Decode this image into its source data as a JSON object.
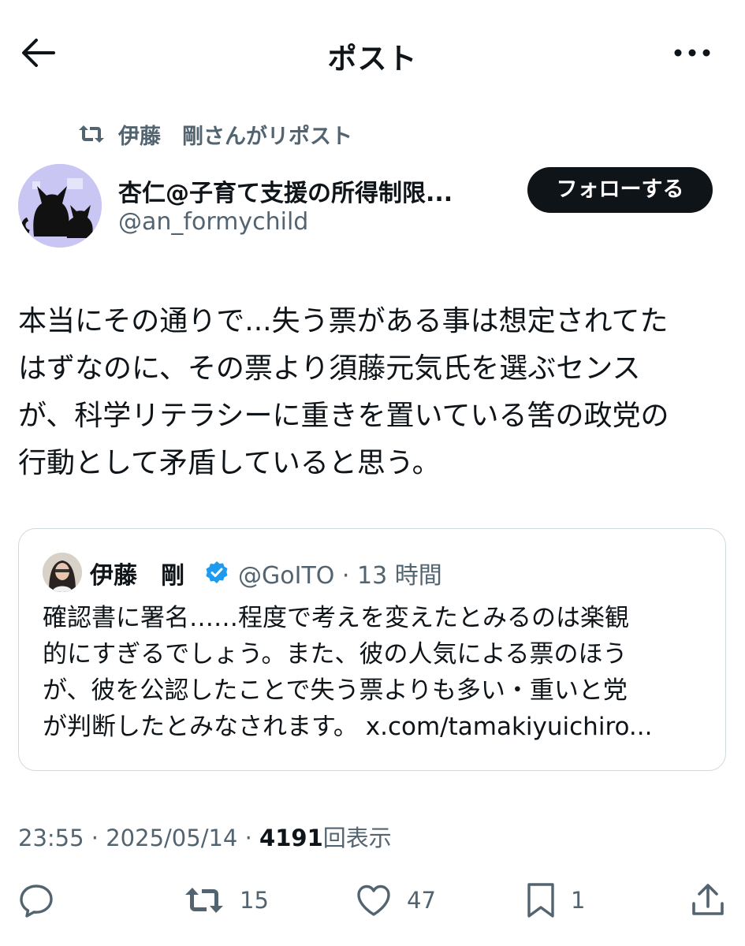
{
  "header": {
    "title": "ポスト"
  },
  "repost": {
    "text": "伊藤　剛さんがリポスト"
  },
  "author": {
    "name": "杏仁@子育て支援の所得制限...",
    "handle": "@an_formychild",
    "follow_label": "フォローする"
  },
  "post": {
    "text": "本当にその通りで...失う票がある事は想定されてた\nはずなのに、その票より須藤元気氏を選ぶセンス\nが、科学リテラシーに重きを置いている筈の政党の\n行動として矛盾していると思う。"
  },
  "quote": {
    "name": "伊藤　剛",
    "handle": "@GoITO · 13 時間",
    "text": "確認書に署名……程度で考えを変えたとみるのは楽観\n的にすぎるでしょう。また、彼の人気による票のほう\nが、彼を公認したことで失う票よりも多い・重いと党\nが判断したとみなされます。",
    "link": "x.com/tamakiyuichiro..."
  },
  "meta": {
    "time": "23:55 · 2025/05/14 · ",
    "views": "4191",
    "views_label": "回表示"
  },
  "actions": {
    "reply": "",
    "reposts": "15",
    "likes": "47",
    "bookmarks": "1"
  },
  "colors": {
    "text": "#0f1419",
    "secondary": "#536471",
    "verified": "#1d9bf0",
    "border": "#cfd9de",
    "button": "#0f1419"
  },
  "icons": [
    "back-arrow-icon",
    "more-icon",
    "repost-icon",
    "verified-icon",
    "reply-icon",
    "like-icon",
    "bookmark-icon",
    "share-icon"
  ]
}
